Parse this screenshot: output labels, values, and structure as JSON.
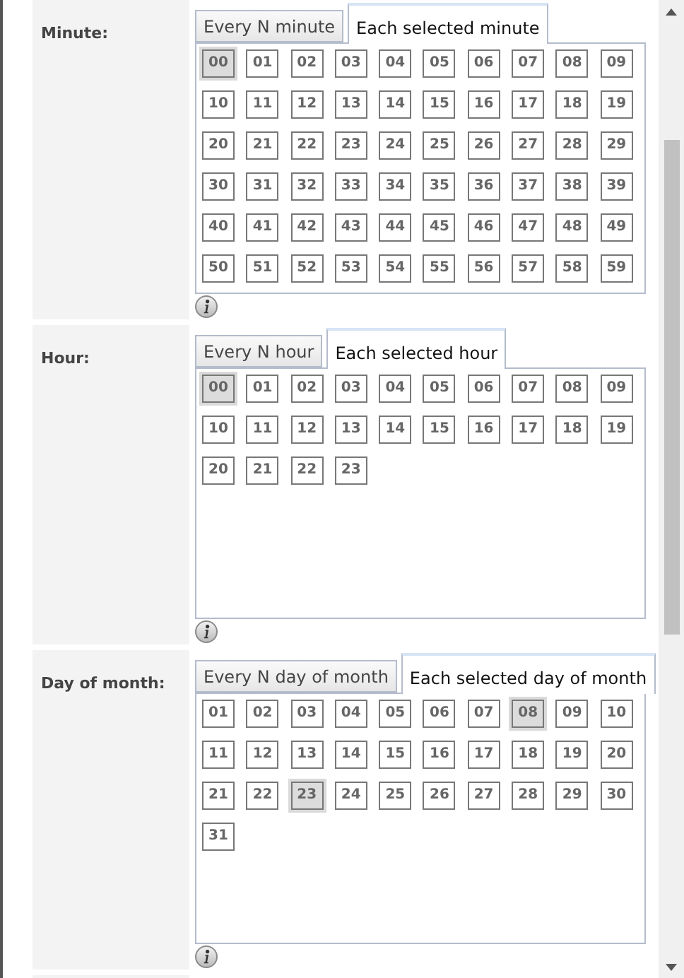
{
  "sections": [
    {
      "label": "Minute:",
      "tabs": [
        {
          "label": "Every N minute",
          "selected": false
        },
        {
          "label": "Each selected minute",
          "selected": true
        }
      ],
      "cells": [
        {
          "label": "00",
          "selected": true
        },
        {
          "label": "01",
          "selected": false
        },
        {
          "label": "02",
          "selected": false
        },
        {
          "label": "03",
          "selected": false
        },
        {
          "label": "04",
          "selected": false
        },
        {
          "label": "05",
          "selected": false
        },
        {
          "label": "06",
          "selected": false
        },
        {
          "label": "07",
          "selected": false
        },
        {
          "label": "08",
          "selected": false
        },
        {
          "label": "09",
          "selected": false
        },
        {
          "label": "10",
          "selected": false
        },
        {
          "label": "11",
          "selected": false
        },
        {
          "label": "12",
          "selected": false
        },
        {
          "label": "13",
          "selected": false
        },
        {
          "label": "14",
          "selected": false
        },
        {
          "label": "15",
          "selected": false
        },
        {
          "label": "16",
          "selected": false
        },
        {
          "label": "17",
          "selected": false
        },
        {
          "label": "18",
          "selected": false
        },
        {
          "label": "19",
          "selected": false
        },
        {
          "label": "20",
          "selected": false
        },
        {
          "label": "21",
          "selected": false
        },
        {
          "label": "22",
          "selected": false
        },
        {
          "label": "23",
          "selected": false
        },
        {
          "label": "24",
          "selected": false
        },
        {
          "label": "25",
          "selected": false
        },
        {
          "label": "26",
          "selected": false
        },
        {
          "label": "27",
          "selected": false
        },
        {
          "label": "28",
          "selected": false
        },
        {
          "label": "29",
          "selected": false
        },
        {
          "label": "30",
          "selected": false
        },
        {
          "label": "31",
          "selected": false
        },
        {
          "label": "32",
          "selected": false
        },
        {
          "label": "33",
          "selected": false
        },
        {
          "label": "34",
          "selected": false
        },
        {
          "label": "35",
          "selected": false
        },
        {
          "label": "36",
          "selected": false
        },
        {
          "label": "37",
          "selected": false
        },
        {
          "label": "38",
          "selected": false
        },
        {
          "label": "39",
          "selected": false
        },
        {
          "label": "40",
          "selected": false
        },
        {
          "label": "41",
          "selected": false
        },
        {
          "label": "42",
          "selected": false
        },
        {
          "label": "43",
          "selected": false
        },
        {
          "label": "44",
          "selected": false
        },
        {
          "label": "45",
          "selected": false
        },
        {
          "label": "46",
          "selected": false
        },
        {
          "label": "47",
          "selected": false
        },
        {
          "label": "48",
          "selected": false
        },
        {
          "label": "49",
          "selected": false
        },
        {
          "label": "50",
          "selected": false
        },
        {
          "label": "51",
          "selected": false
        },
        {
          "label": "52",
          "selected": false
        },
        {
          "label": "53",
          "selected": false
        },
        {
          "label": "54",
          "selected": false
        },
        {
          "label": "55",
          "selected": false
        },
        {
          "label": "56",
          "selected": false
        },
        {
          "label": "57",
          "selected": false
        },
        {
          "label": "58",
          "selected": false
        },
        {
          "label": "59",
          "selected": false
        }
      ]
    },
    {
      "label": "Hour:",
      "tabs": [
        {
          "label": "Every N hour",
          "selected": false
        },
        {
          "label": "Each selected hour",
          "selected": true
        }
      ],
      "cells": [
        {
          "label": "00",
          "selected": true
        },
        {
          "label": "01",
          "selected": false
        },
        {
          "label": "02",
          "selected": false
        },
        {
          "label": "03",
          "selected": false
        },
        {
          "label": "04",
          "selected": false
        },
        {
          "label": "05",
          "selected": false
        },
        {
          "label": "06",
          "selected": false
        },
        {
          "label": "07",
          "selected": false
        },
        {
          "label": "08",
          "selected": false
        },
        {
          "label": "09",
          "selected": false
        },
        {
          "label": "10",
          "selected": false
        },
        {
          "label": "11",
          "selected": false
        },
        {
          "label": "12",
          "selected": false
        },
        {
          "label": "13",
          "selected": false
        },
        {
          "label": "14",
          "selected": false
        },
        {
          "label": "15",
          "selected": false
        },
        {
          "label": "16",
          "selected": false
        },
        {
          "label": "17",
          "selected": false
        },
        {
          "label": "18",
          "selected": false
        },
        {
          "label": "19",
          "selected": false
        },
        {
          "label": "20",
          "selected": false
        },
        {
          "label": "21",
          "selected": false
        },
        {
          "label": "22",
          "selected": false
        },
        {
          "label": "23",
          "selected": false
        }
      ]
    },
    {
      "label": "Day of month:",
      "tabs": [
        {
          "label": "Every N day of month",
          "selected": false
        },
        {
          "label": "Each selected day of month",
          "selected": true
        }
      ],
      "cells": [
        {
          "label": "01",
          "selected": false
        },
        {
          "label": "02",
          "selected": false
        },
        {
          "label": "03",
          "selected": false
        },
        {
          "label": "04",
          "selected": false
        },
        {
          "label": "05",
          "selected": false
        },
        {
          "label": "06",
          "selected": false
        },
        {
          "label": "07",
          "selected": false
        },
        {
          "label": "08",
          "selected": true
        },
        {
          "label": "09",
          "selected": false
        },
        {
          "label": "10",
          "selected": false
        },
        {
          "label": "11",
          "selected": false
        },
        {
          "label": "12",
          "selected": false
        },
        {
          "label": "13",
          "selected": false
        },
        {
          "label": "14",
          "selected": false
        },
        {
          "label": "15",
          "selected": false
        },
        {
          "label": "16",
          "selected": false
        },
        {
          "label": "17",
          "selected": false
        },
        {
          "label": "18",
          "selected": false
        },
        {
          "label": "19",
          "selected": false
        },
        {
          "label": "20",
          "selected": false
        },
        {
          "label": "21",
          "selected": false
        },
        {
          "label": "22",
          "selected": false
        },
        {
          "label": "23",
          "selected": true
        },
        {
          "label": "24",
          "selected": false
        },
        {
          "label": "25",
          "selected": false
        },
        {
          "label": "26",
          "selected": false
        },
        {
          "label": "27",
          "selected": false
        },
        {
          "label": "28",
          "selected": false
        },
        {
          "label": "29",
          "selected": false
        },
        {
          "label": "30",
          "selected": false
        },
        {
          "label": "31",
          "selected": false
        }
      ]
    }
  ]
}
